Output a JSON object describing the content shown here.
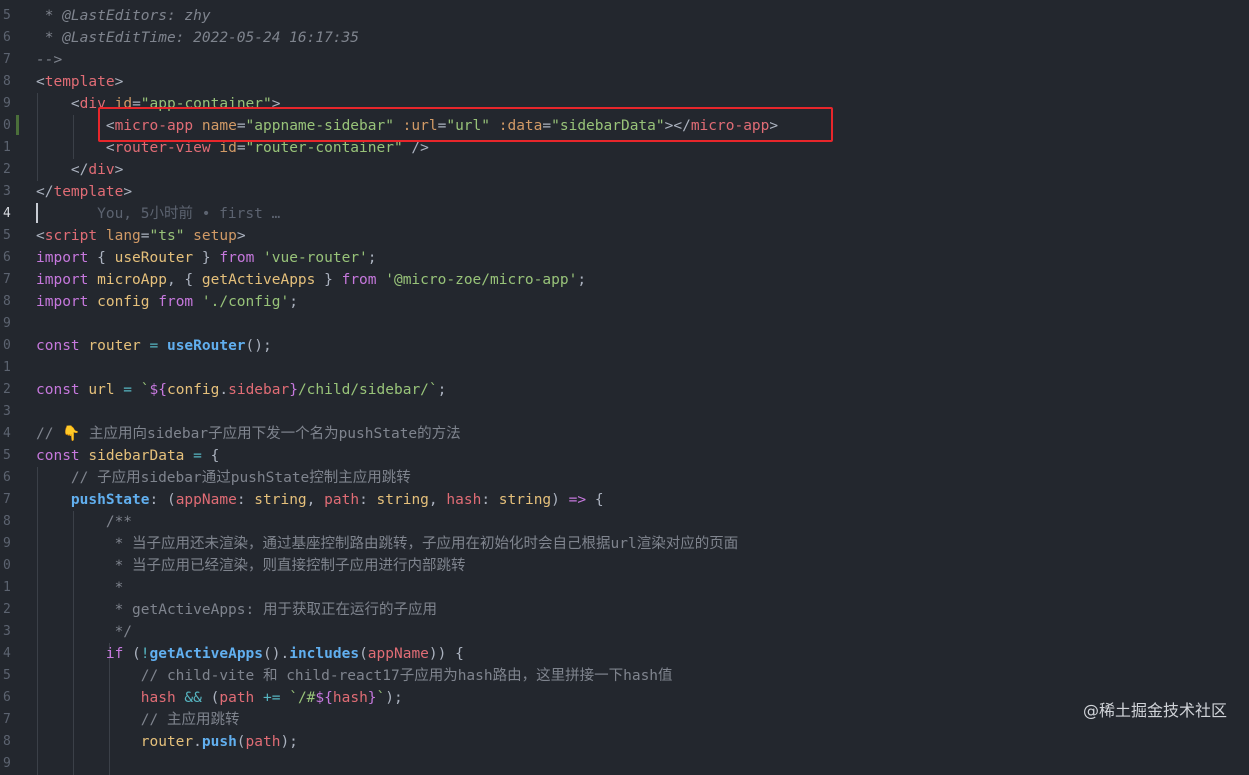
{
  "editor": {
    "line_numbers": [
      "5",
      "6",
      "7",
      "8",
      "9",
      "0",
      "1",
      "2",
      "3",
      "4",
      "5",
      "6",
      "7",
      "8",
      "9",
      "0",
      "1",
      "2",
      "3",
      "4",
      "5",
      "6",
      "7",
      "8",
      "9",
      "0",
      "1",
      "2",
      "3",
      "4",
      "5",
      "6",
      "7",
      "8",
      "9"
    ],
    "active_line_index": 9,
    "ghost_blame": "You, 5小时前 • first …",
    "watermark": "@稀土掘金技术社区",
    "colors": {
      "background": "#23272e",
      "highlight_box": "#e8262b",
      "comment": "#7f848e",
      "tag": "#e06c75",
      "string": "#98c379",
      "keyword": "#c678dd",
      "function": "#61afef",
      "variable": "#e5c07b"
    },
    "lines": [
      [
        {
          "c": "c-cmt-it",
          "t": " * @LastEditors: zhy"
        }
      ],
      [
        {
          "c": "c-cmt-it",
          "t": " * @LastEditTime: 2022-05-24 16:17:35"
        }
      ],
      [
        {
          "c": "c-cmt-it",
          "t": "-->"
        }
      ],
      [
        {
          "c": "c-punc",
          "t": "<"
        },
        {
          "c": "c-tag",
          "t": "template"
        },
        {
          "c": "c-punc",
          "t": ">"
        }
      ],
      [
        {
          "c": "c-punc",
          "t": "    <"
        },
        {
          "c": "c-tag",
          "t": "div"
        },
        {
          "c": "c-attr",
          "t": " id"
        },
        {
          "c": "c-punc",
          "t": "="
        },
        {
          "c": "c-str",
          "t": "\"app-container\""
        },
        {
          "c": "c-punc",
          "t": ">"
        }
      ],
      [
        {
          "c": "c-punc",
          "t": "        <"
        },
        {
          "c": "c-tag",
          "t": "micro-app"
        },
        {
          "c": "c-attr",
          "t": " name"
        },
        {
          "c": "c-punc",
          "t": "="
        },
        {
          "c": "c-str",
          "t": "\"appname-sidebar\""
        },
        {
          "c": "c-attr",
          "t": " :url"
        },
        {
          "c": "c-punc",
          "t": "="
        },
        {
          "c": "c-str",
          "t": "\"url\""
        },
        {
          "c": "c-attr",
          "t": " :data"
        },
        {
          "c": "c-punc",
          "t": "="
        },
        {
          "c": "c-str",
          "t": "\"sidebarData\""
        },
        {
          "c": "c-punc",
          "t": "></"
        },
        {
          "c": "c-tag",
          "t": "micro-app"
        },
        {
          "c": "c-punc",
          "t": ">"
        }
      ],
      [
        {
          "c": "c-punc",
          "t": "        <"
        },
        {
          "c": "c-tag",
          "t": "router-view"
        },
        {
          "c": "c-attr",
          "t": " id"
        },
        {
          "c": "c-punc",
          "t": "="
        },
        {
          "c": "c-str",
          "t": "\"router-container\""
        },
        {
          "c": "c-punc",
          "t": " />"
        }
      ],
      [
        {
          "c": "c-punc",
          "t": "    </"
        },
        {
          "c": "c-tag",
          "t": "div"
        },
        {
          "c": "c-punc",
          "t": ">"
        }
      ],
      [
        {
          "c": "c-punc",
          "t": "</"
        },
        {
          "c": "c-tag",
          "t": "template"
        },
        {
          "c": "c-punc",
          "t": ">"
        }
      ],
      [],
      [
        {
          "c": "c-punc",
          "t": "<"
        },
        {
          "c": "c-tag",
          "t": "script"
        },
        {
          "c": "c-attr",
          "t": " lang"
        },
        {
          "c": "c-punc",
          "t": "="
        },
        {
          "c": "c-str",
          "t": "\"ts\""
        },
        {
          "c": "c-attr",
          "t": " setup"
        },
        {
          "c": "c-punc",
          "t": ">"
        }
      ],
      [
        {
          "c": "c-kw",
          "t": "import"
        },
        {
          "c": "c-punc",
          "t": " { "
        },
        {
          "c": "c-var",
          "t": "useRouter"
        },
        {
          "c": "c-punc",
          "t": " } "
        },
        {
          "c": "c-kw",
          "t": "from"
        },
        {
          "c": "c-str",
          "t": " 'vue-router'"
        },
        {
          "c": "c-punc",
          "t": ";"
        }
      ],
      [
        {
          "c": "c-kw",
          "t": "import"
        },
        {
          "c": "c-var",
          "t": " microApp"
        },
        {
          "c": "c-punc",
          "t": ", { "
        },
        {
          "c": "c-var",
          "t": "getActiveApps"
        },
        {
          "c": "c-punc",
          "t": " } "
        },
        {
          "c": "c-kw",
          "t": "from"
        },
        {
          "c": "c-str",
          "t": " '@micro-zoe/micro-app'"
        },
        {
          "c": "c-punc",
          "t": ";"
        }
      ],
      [
        {
          "c": "c-kw",
          "t": "import"
        },
        {
          "c": "c-var",
          "t": " config"
        },
        {
          "c": "c-kw",
          "t": " from"
        },
        {
          "c": "c-str",
          "t": " './config'"
        },
        {
          "c": "c-punc",
          "t": ";"
        }
      ],
      [],
      [
        {
          "c": "c-kw",
          "t": "const"
        },
        {
          "c": "c-var",
          "t": " router"
        },
        {
          "c": "c-op",
          "t": " ="
        },
        {
          "c": "c-fn",
          "t": " useRouter"
        },
        {
          "c": "c-punc",
          "t": "();"
        }
      ],
      [],
      [
        {
          "c": "c-kw",
          "t": "const"
        },
        {
          "c": "c-var",
          "t": " url"
        },
        {
          "c": "c-op",
          "t": " ="
        },
        {
          "c": "c-str",
          "t": " `"
        },
        {
          "c": "c-kw",
          "t": "${"
        },
        {
          "c": "c-var",
          "t": "config"
        },
        {
          "c": "c-punc",
          "t": "."
        },
        {
          "c": "c-prop",
          "t": "sidebar"
        },
        {
          "c": "c-kw",
          "t": "}"
        },
        {
          "c": "c-str",
          "t": "/child/sidebar/`"
        },
        {
          "c": "c-punc",
          "t": ";"
        }
      ],
      [],
      [
        {
          "c": "c-comment",
          "t": "// 👇 主应用向sidebar子应用下发一个名为pushState的方法"
        }
      ],
      [
        {
          "c": "c-kw",
          "t": "const"
        },
        {
          "c": "c-var",
          "t": " sidebarData"
        },
        {
          "c": "c-op",
          "t": " ="
        },
        {
          "c": "c-punc",
          "t": " {"
        }
      ],
      [
        {
          "c": "c-comment",
          "t": "    // 子应用sidebar通过pushState控制主应用跳转"
        }
      ],
      [
        {
          "c": "c-fn",
          "t": "    pushState"
        },
        {
          "c": "c-punc",
          "t": ": ("
        },
        {
          "c": "c-prop",
          "t": "appName"
        },
        {
          "c": "c-punc",
          "t": ": "
        },
        {
          "c": "c-type",
          "t": "string"
        },
        {
          "c": "c-punc",
          "t": ", "
        },
        {
          "c": "c-prop",
          "t": "path"
        },
        {
          "c": "c-punc",
          "t": ": "
        },
        {
          "c": "c-type",
          "t": "string"
        },
        {
          "c": "c-punc",
          "t": ", "
        },
        {
          "c": "c-prop",
          "t": "hash"
        },
        {
          "c": "c-punc",
          "t": ": "
        },
        {
          "c": "c-type",
          "t": "string"
        },
        {
          "c": "c-punc",
          "t": ") "
        },
        {
          "c": "c-kw",
          "t": "=>"
        },
        {
          "c": "c-punc",
          "t": " {"
        }
      ],
      [
        {
          "c": "c-comment",
          "t": "        /**"
        }
      ],
      [
        {
          "c": "c-comment",
          "t": "         * 当子应用还未渲染，通过基座控制路由跳转，子应用在初始化时会自己根据url渲染对应的页面"
        }
      ],
      [
        {
          "c": "c-comment",
          "t": "         * 当子应用已经渲染，则直接控制子应用进行内部跳转"
        }
      ],
      [
        {
          "c": "c-comment",
          "t": "         *"
        }
      ],
      [
        {
          "c": "c-comment",
          "t": "         * getActiveApps: 用于获取正在运行的子应用"
        }
      ],
      [
        {
          "c": "c-comment",
          "t": "         */"
        }
      ],
      [
        {
          "c": "c-kw",
          "t": "        if"
        },
        {
          "c": "c-punc",
          "t": " ("
        },
        {
          "c": "c-op",
          "t": "!"
        },
        {
          "c": "c-fn",
          "t": "getActiveApps"
        },
        {
          "c": "c-punc",
          "t": "()."
        },
        {
          "c": "c-fn",
          "t": "includes"
        },
        {
          "c": "c-punc",
          "t": "("
        },
        {
          "c": "c-prop",
          "t": "appName"
        },
        {
          "c": "c-punc",
          "t": ")) {"
        }
      ],
      [
        {
          "c": "c-comment",
          "t": "            // child-vite 和 child-react17子应用为hash路由，这里拼接一下hash值"
        }
      ],
      [
        {
          "c": "c-prop",
          "t": "            hash"
        },
        {
          "c": "c-op",
          "t": " &&"
        },
        {
          "c": "c-punc",
          "t": " ("
        },
        {
          "c": "c-prop",
          "t": "path"
        },
        {
          "c": "c-op",
          "t": " +="
        },
        {
          "c": "c-str",
          "t": " `/#"
        },
        {
          "c": "c-kw",
          "t": "${"
        },
        {
          "c": "c-prop",
          "t": "hash"
        },
        {
          "c": "c-kw",
          "t": "}"
        },
        {
          "c": "c-str",
          "t": "`"
        },
        {
          "c": "c-punc",
          "t": ");"
        }
      ],
      [
        {
          "c": "c-comment",
          "t": "            // 主应用跳转"
        }
      ],
      [
        {
          "c": "c-var",
          "t": "            router"
        },
        {
          "c": "c-punc",
          "t": "."
        },
        {
          "c": "c-fn",
          "t": "push"
        },
        {
          "c": "c-punc",
          "t": "("
        },
        {
          "c": "c-prop",
          "t": "path"
        },
        {
          "c": "c-punc",
          "t": ");"
        }
      ]
    ]
  }
}
